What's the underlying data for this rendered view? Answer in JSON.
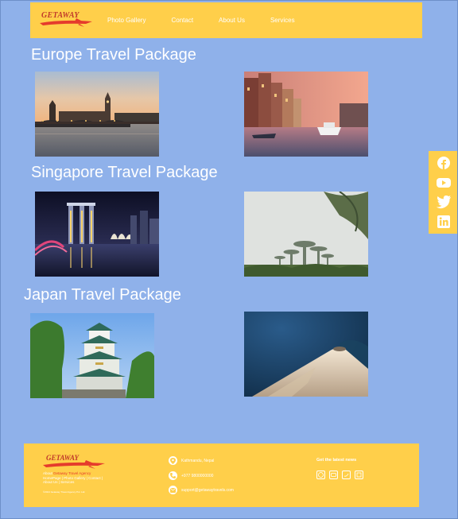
{
  "nav": {
    "logo_text": "GETAWAY",
    "links": [
      "Photo Gallery",
      "Contact",
      "About Us",
      "Services"
    ]
  },
  "sections": [
    {
      "title": "Europe Travel Package"
    },
    {
      "title": "Singapore Travel Package"
    },
    {
      "title": "Japan Travel Package"
    }
  ],
  "social": [
    "facebook-icon",
    "youtube-icon",
    "twitter-icon",
    "linkedin-icon"
  ],
  "footer": {
    "logo_text": "GETAWAY",
    "about_prefix": "About",
    "brand": "Getaway Travel Agency",
    "links_line1": "HomePage | Photo Gallery | Contact |",
    "links_line2": "About Us | Services",
    "copyright": "©2024 Getaway Travel Agency Pvt. Ltd.",
    "address": "Kathmandu, Nepal",
    "phone": "+977 9800000000",
    "email": "support@getawaytravels.com",
    "news_title": "Get the latest news"
  },
  "colors": {
    "background": "#8fb1ea",
    "accent": "#ffcf4a",
    "brand_red": "#e53b2c"
  }
}
